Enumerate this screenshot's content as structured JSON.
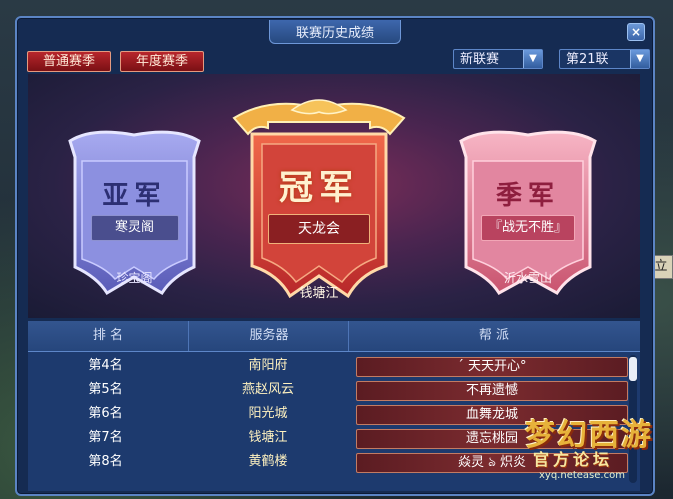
{
  "window": {
    "title": "联赛历史成绩",
    "close_label": "×"
  },
  "tabs": [
    {
      "label": "普通赛季"
    },
    {
      "label": "年度赛季"
    }
  ],
  "filters": {
    "league": {
      "value": "新联赛",
      "arrow": "▼"
    },
    "season": {
      "value": "第21联",
      "arrow": "▼"
    }
  },
  "podium": {
    "champion": {
      "rank": "冠军",
      "guild": "天龙会",
      "server": "钱塘江"
    },
    "runner_up": {
      "rank": "亚军",
      "guild": "寒灵阁",
      "server": "珍宝阁"
    },
    "third": {
      "rank": "季军",
      "guild": "『战无不胜』",
      "server": "沂水雪山"
    }
  },
  "table": {
    "headers": {
      "rank": "排 名",
      "server": "服务器",
      "guild": "帮 派"
    },
    "rows": [
      {
        "rank": "第4名",
        "server": "南阳府",
        "guild": "´ 天天开心°"
      },
      {
        "rank": "第5名",
        "server": "燕赵风云",
        "guild": "不再遗憾"
      },
      {
        "rank": "第6名",
        "server": "阳光城",
        "guild": "血舞龙城"
      },
      {
        "rank": "第7名",
        "server": "钱塘江",
        "guild": "遗忘桃园"
      },
      {
        "rank": "第8名",
        "server": "黄鹤楼",
        "guild": "焱灵 ঌ 炽炎"
      }
    ]
  },
  "background": {
    "side_tag": "立"
  },
  "watermark": {
    "title": "梦幻西游",
    "subtitle": "官方论坛",
    "url": "xyq.netease.com"
  },
  "colors": {
    "tab_red": "#b8262c",
    "frame_blue": "#5b84c4",
    "champion_red": "#d4403a",
    "runner_up_purple": "#7c7fd0",
    "third_pink": "#e0869c"
  }
}
